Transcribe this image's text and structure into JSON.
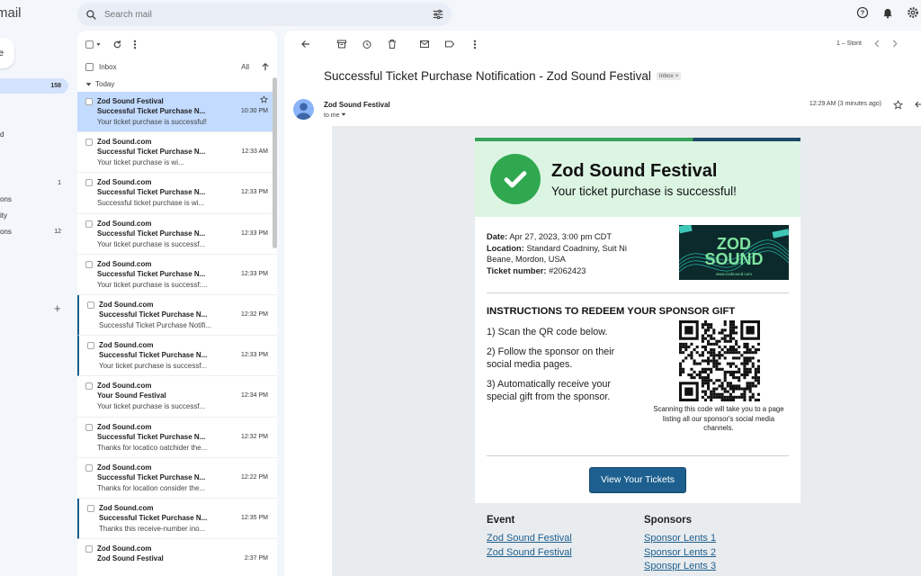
{
  "app": {
    "title": "mail"
  },
  "search": {
    "placeholder": "Search mail"
  },
  "compose": {
    "label": "e"
  },
  "nav": [
    {
      "label": "",
      "count": "158",
      "active": true
    },
    {
      "label": "d",
      "count": ""
    },
    {
      "label": "",
      "count": "1"
    },
    {
      "label": "ons",
      "count": ""
    },
    {
      "label": "ity",
      "count": ""
    },
    {
      "label": "ons",
      "count": "12"
    }
  ],
  "list": {
    "header_label": "Inbox",
    "filter_all": "All",
    "group_label": "Today",
    "rows": [
      {
        "sender": "Zod Sound Festival",
        "subject": "Successful Ticket Purchase N...",
        "snippet": "Your ticket purchase is successful!",
        "time": "10:30 PM",
        "selected": true,
        "marked": false
      },
      {
        "sender": "Zod Sound.com",
        "subject": "Successful Ticket Purchase N...",
        "snippet": "Your ticket purchase is wi...",
        "time": "12:33 AM",
        "selected": false,
        "marked": false
      },
      {
        "sender": "Zod Sound.com",
        "subject": "Successful Ticket Purchase N...",
        "snippet": "Successful ticket purchase is wi...",
        "time": "12:33 PM",
        "selected": false,
        "marked": false
      },
      {
        "sender": "Zod Sound.com",
        "subject": "Successful Ticket Purchase N...",
        "snippet": "Your ticket purchase is successf...",
        "time": "12:33 PM",
        "selected": false,
        "marked": false
      },
      {
        "sender": "Zod Sound.com",
        "subject": "Successful Ticket Purchase N...",
        "snippet": "Your ticket purchase is successf:...",
        "time": "12:33 PM",
        "selected": false,
        "marked": false
      },
      {
        "sender": "Zod Sound.com",
        "subject": "Successful Ticket Purchase N...",
        "snippet": "Successful Ticket Purchase Notifi...",
        "time": "12:32 PM",
        "selected": false,
        "marked": true
      },
      {
        "sender": "Zod Sound.com",
        "subject": "Successful Ticket Purchase N...",
        "snippet": "Your ticket purchase is successf...",
        "time": "12:33 PM",
        "selected": false,
        "marked": true
      },
      {
        "sender": "Zod Sound.com",
        "subject": "Your Sound Festival",
        "snippet": "Your ticket purchase is successf...",
        "time": "12:34 PM",
        "selected": false,
        "marked": false
      },
      {
        "sender": "Zod Sound.com",
        "subject": "Successful Ticket Purchase N...",
        "snippet": "Thanks for locatico oatchider the...",
        "time": "12:32 PM",
        "selected": false,
        "marked": false
      },
      {
        "sender": "Zod Sound.com",
        "subject": "Successful Ticket Purchase N...",
        "snippet": "Thanks for location consider the...",
        "time": "12:22 PM",
        "selected": false,
        "marked": false
      },
      {
        "sender": "Zod Sound.com",
        "subject": "Successful Ticket Purchase N...",
        "snippet": "Thanks this receive-number ino...",
        "time": "12:35 PM",
        "selected": false,
        "marked": true
      },
      {
        "sender": "Zod Sound.com",
        "subject": "Zod Sound Festival",
        "snippet": "",
        "time": "2:37 PM",
        "selected": false,
        "marked": false
      }
    ]
  },
  "reader": {
    "pager": "1 – Stont",
    "subject": "Successful Ticket Purchase Notification - Zod Sound Festival",
    "inbox_badge": "Inbox ×",
    "from": "Zod Sound Festival",
    "to": "to me",
    "time": "12:29 AM (3 minutes ago)"
  },
  "email": {
    "hero_title": "Zod Sound Festival",
    "hero_sub": "Your ticket purchase is successful!",
    "date_label": "Date:",
    "date_value": "Apr 27, 2023, 3:00 pm CDT",
    "location_label": "Location:",
    "location_value": "Standard Coadniny, Suit Ni Beane, Mordon, USA",
    "ticket_label": "Ticket number:",
    "ticket_value": "#2062423",
    "logo_line1": "ZOD",
    "logo_line2": "SOUND",
    "logo_url": "www.zodsound.com",
    "instructions_title": "INSTRUCTIONS TO REDEEM YOUR SPONSOR GIFT",
    "step1": "1) Scan the QR code below.",
    "step2": "2) Follow the sponsor on their social media pages.",
    "step3": "3) Automatically receive your special gift from the sponsor.",
    "qr_caption": "Scanning this code will take you to a page listing all our sponsor's social media channels.",
    "button": "View Your Tickets",
    "event_title": "Event",
    "event_links": [
      "Zod Sound Festival",
      "Zod Sound Festival"
    ],
    "sponsors_title": "Sponsors",
    "sponsor_links": [
      "Sponsor Lents 1",
      "Sponsor Lents 2",
      "Sponspr Lents 3"
    ]
  },
  "colors": {
    "selected_row": "#c2dbff",
    "accent_green": "#2fa84f",
    "hero_bg": "#dcf5e3",
    "button_blue": "#1d5f8e"
  }
}
